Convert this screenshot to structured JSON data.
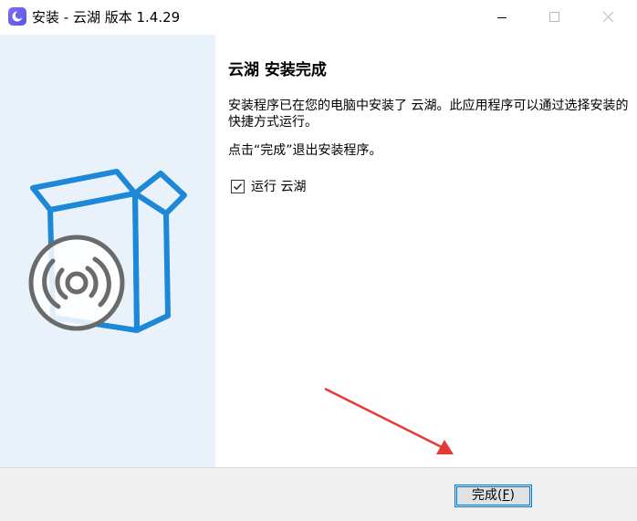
{
  "window": {
    "title": "安装 - 云湖 版本 1.4.29"
  },
  "content": {
    "heading": "云湖 安装完成",
    "paragraph1": "安装程序已在您的电脑中安装了 云湖。此应用程序可以通过选择安装的快捷方式运行。",
    "paragraph2": "点击“完成”退出安装程序。",
    "run_checkbox": {
      "label": "运行 云湖",
      "checked": true
    }
  },
  "footer": {
    "finish_label": "完成(",
    "finish_accel": "F",
    "finish_suffix": ")"
  },
  "colors": {
    "side_panel_bg": "#e9f2fa",
    "box_blue": "#1e88d8",
    "disc_gray": "#6a6a6a",
    "annotation_red": "#e53935",
    "button_border": "#0078d7"
  },
  "icons": {
    "app": "yunhu-app-icon",
    "minimize": "minimize-icon",
    "maximize": "maximize-icon",
    "close": "close-icon",
    "installer": "installer-box-disc-icon",
    "checkmark": "checkmark-icon"
  }
}
